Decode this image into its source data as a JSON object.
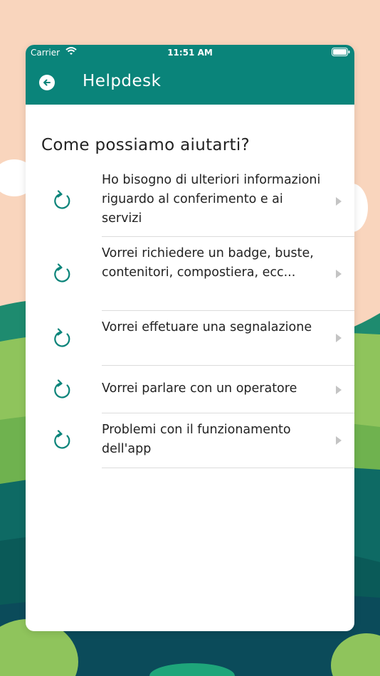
{
  "colors": {
    "primary": "#0a847a",
    "background": "#f9d5bd",
    "divider": "#dcdcdc",
    "chevron": "#c4c4c4"
  },
  "status_bar": {
    "carrier": "Carrier",
    "time": "11:51 AM"
  },
  "header": {
    "title": "Helpdesk",
    "back_icon": "arrow-left-circle-icon"
  },
  "main": {
    "heading": "Come possiamo aiutarti?",
    "items": [
      {
        "label": "Ho bisogno di ulteriori informazioni riguardo al conferimento e ai servizi",
        "icon": "refresh-icon"
      },
      {
        "label": "Vorrei richiedere un badge, buste, contenitori, compostiera, ecc...",
        "icon": "refresh-icon"
      },
      {
        "label": "Vorrei effetuare una segnalazione",
        "icon": "refresh-icon"
      },
      {
        "label": "Vorrei parlare con un operatore",
        "icon": "refresh-icon"
      },
      {
        "label": "Problemi con il funzionamento dell'app",
        "icon": "refresh-icon"
      }
    ]
  }
}
